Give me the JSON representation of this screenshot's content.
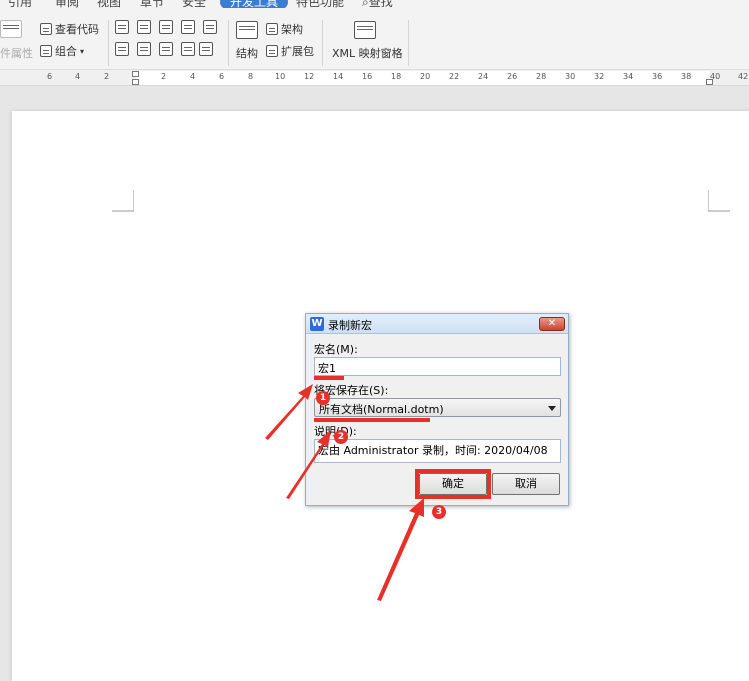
{
  "tabs": {
    "items": [
      {
        "label": "引用",
        "active": false
      },
      {
        "label": "审阅",
        "active": false
      },
      {
        "label": "视图",
        "active": false
      },
      {
        "label": "章节",
        "active": false
      },
      {
        "label": "安全",
        "active": false
      },
      {
        "label": "开发工具",
        "active": true
      },
      {
        "label": "特色功能",
        "active": false
      }
    ],
    "search_label": "查找"
  },
  "ribbon": {
    "control_props": "件属性",
    "view_code": "查看代码",
    "combine": "组合",
    "architecture": "架构",
    "structure": "结构",
    "expansion_pack": "扩展包",
    "xml_pane": "XML 映射窗格"
  },
  "ruler": {
    "labels": [
      "6",
      "4",
      "2",
      "2",
      "4",
      "6",
      "8",
      "10",
      "12",
      "14",
      "16",
      "18",
      "20",
      "22",
      "24",
      "26",
      "28",
      "30",
      "32",
      "34",
      "36",
      "38",
      "40",
      "42"
    ]
  },
  "dialog": {
    "title": "录制新宏",
    "macro_name_label": "宏名(M):",
    "macro_name_value": "宏1",
    "save_in_label": "将宏保存在(S):",
    "save_in_value": "所有文档(Normal.dotm)",
    "description_label": "说明(D):",
    "description_value": "宏由 Administrator 录制，时间: 2020/04/08",
    "ok_label": "确定",
    "cancel_label": "取消",
    "close_glyph": "✕"
  },
  "annotations": {
    "badge_1": "1",
    "badge_2": "2",
    "badge_3": "3",
    "color": "#e8302a"
  }
}
